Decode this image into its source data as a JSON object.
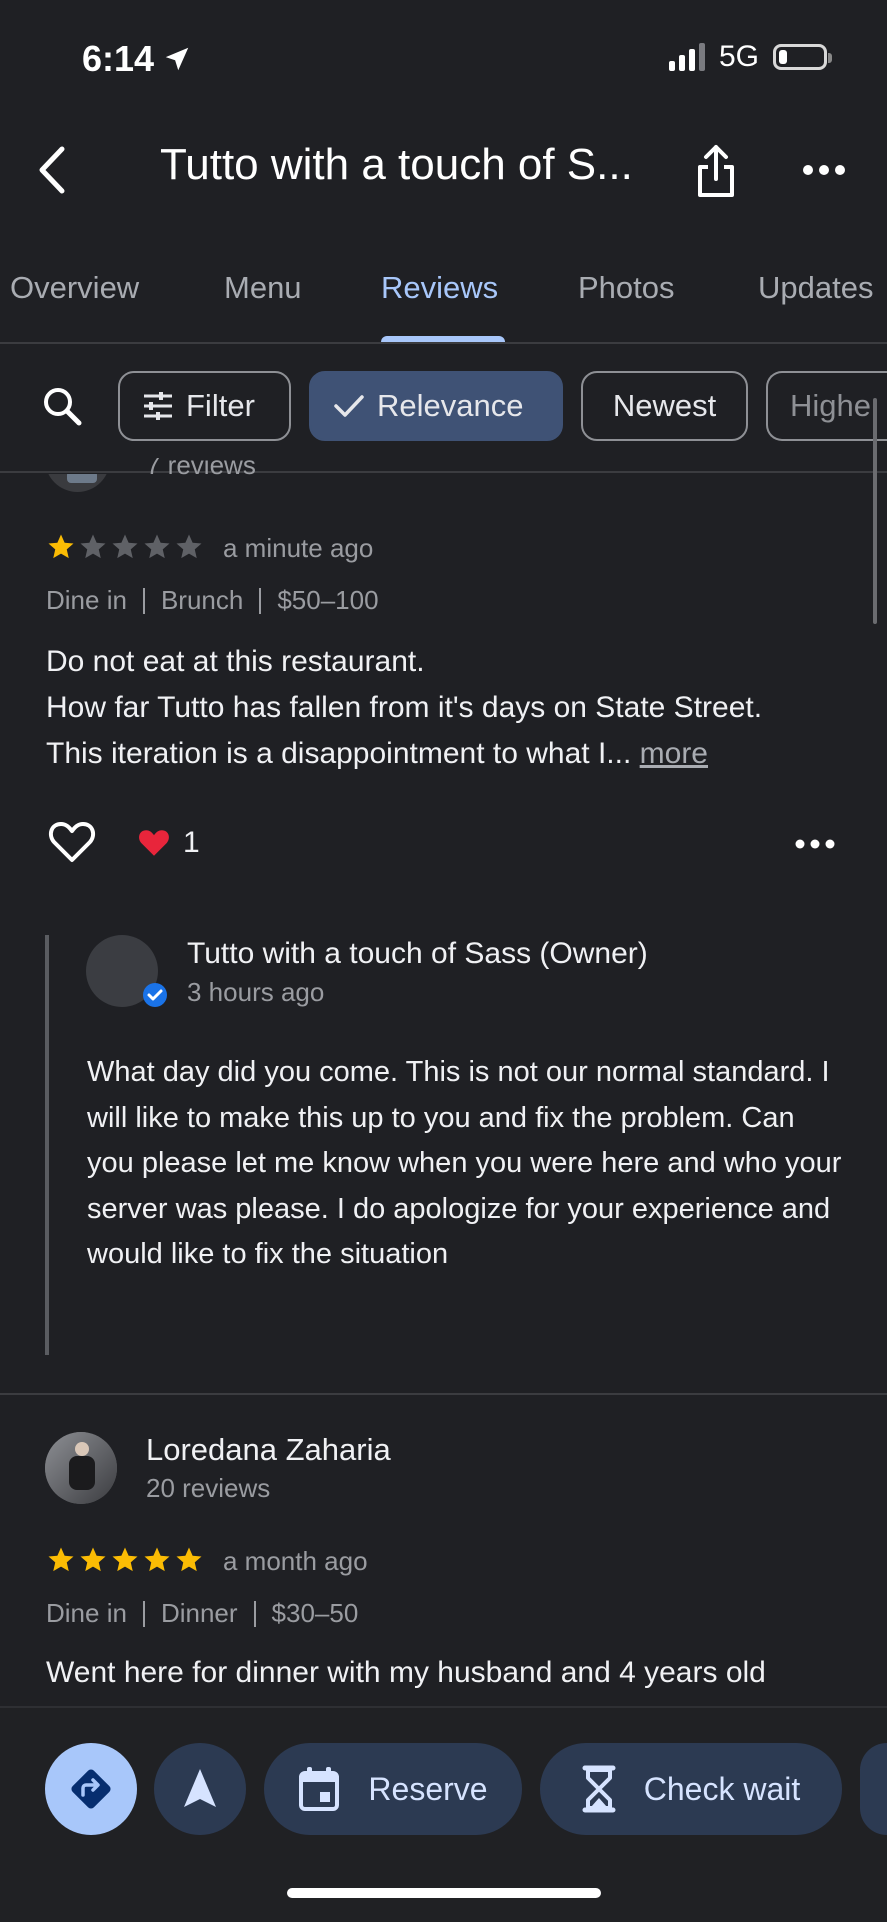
{
  "status_bar": {
    "time": "6:14",
    "network": "5G"
  },
  "header": {
    "title": "Tutto with a touch of S..."
  },
  "tabs": [
    {
      "label": "Overview",
      "active": false
    },
    {
      "label": "Menu",
      "active": false
    },
    {
      "label": "Reviews",
      "active": true
    },
    {
      "label": "Photos",
      "active": false
    },
    {
      "label": "Updates",
      "active": false
    }
  ],
  "chips": {
    "filter": "Filter",
    "relevance": "Relevance",
    "newest": "Newest",
    "highest": "Highe"
  },
  "review1": {
    "reviews_count": "7 reviews",
    "rating": 1,
    "time": "a minute ago",
    "meta": [
      "Dine in",
      "Brunch",
      "$50–100"
    ],
    "text_lines": [
      "Do not eat at this restaurant.",
      "How far Tutto has fallen from it's days on State Street.",
      "This iteration is a disappointment to what I... "
    ],
    "more": "more",
    "likes": "1",
    "owner_reply": {
      "name": "Tutto with a touch of Sass (Owner)",
      "time": "3 hours ago",
      "text": "What day did you come.  This is not our normal standard.  I will like to make this up to you and fix the problem.  Can you please let me know when you were here and who your server was please.  I do apologize for your experience and would like to fix the situation"
    }
  },
  "review2": {
    "name": "Loredana Zaharia",
    "reviews_count": "20 reviews",
    "rating": 5,
    "time": "a month ago",
    "meta": [
      "Dine in",
      "Dinner",
      "$30–50"
    ],
    "text": "Went here for dinner with my husband and 4 years old"
  },
  "actions": {
    "reserve": "Reserve",
    "check_wait": "Check wait"
  },
  "colors": {
    "background": "#1f2024",
    "accent": "#a8c7fa",
    "star": "#fbbc04",
    "chip_selected": "#3f5275",
    "pill": "#2c3a52"
  }
}
